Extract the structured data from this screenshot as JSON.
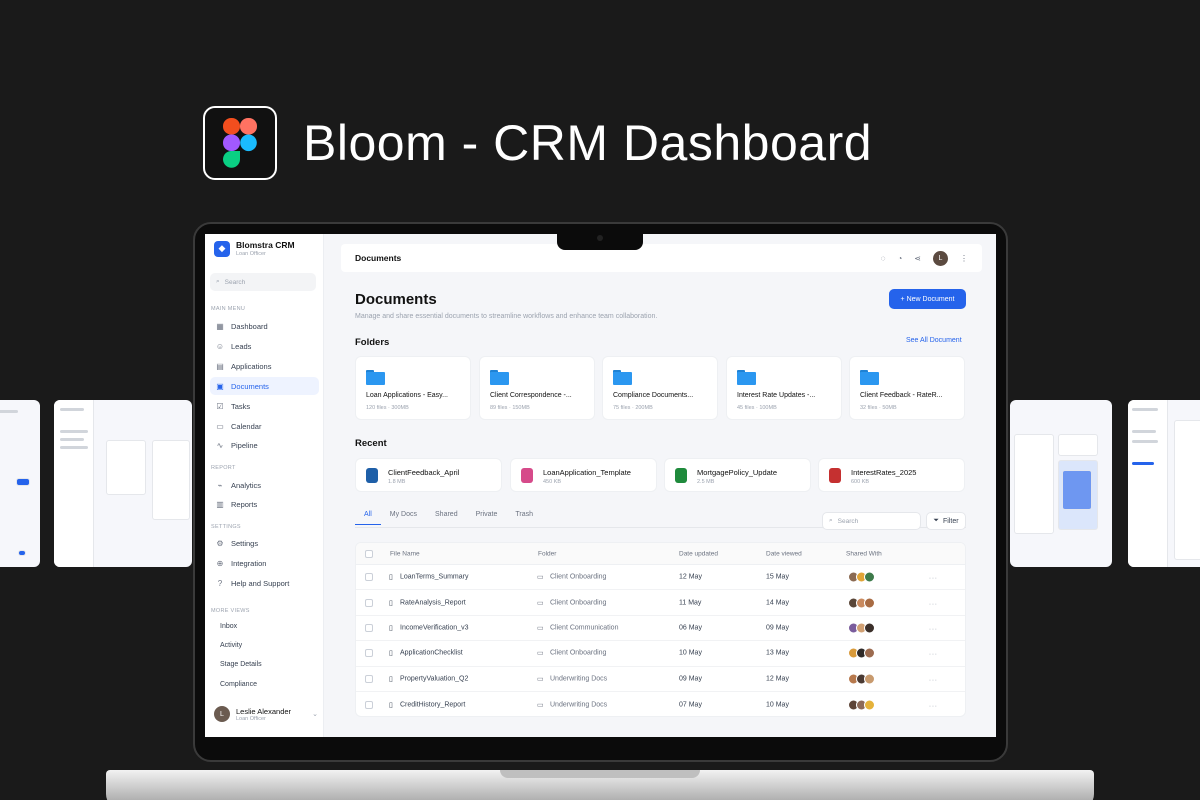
{
  "hero": {
    "title": "Bloom - CRM Dashboard",
    "logo_icon": "figma-logo-icon"
  },
  "sidebar": {
    "brand_name": "Blomstra CRM",
    "brand_role": "Loan Officer",
    "search_placeholder": "Search",
    "main_menu_title": "MAIN MENU",
    "main_items": [
      {
        "label": "Dashboard",
        "icon": "grid-icon"
      },
      {
        "label": "Leads",
        "icon": "users-icon"
      },
      {
        "label": "Applications",
        "icon": "document-icon"
      },
      {
        "label": "Documents",
        "icon": "file-icon",
        "active": true
      },
      {
        "label": "Tasks",
        "icon": "checkbox-icon"
      },
      {
        "label": "Calendar",
        "icon": "calendar-icon"
      },
      {
        "label": "Pipeline",
        "icon": "pipeline-icon"
      }
    ],
    "report_title": "REPORT",
    "report_items": [
      {
        "label": "Analytics",
        "icon": "analytics-icon"
      },
      {
        "label": "Reports",
        "icon": "reports-icon"
      }
    ],
    "settings_title": "SETTINGS",
    "settings_items": [
      {
        "label": "Settings",
        "icon": "gear-icon"
      },
      {
        "label": "Integration",
        "icon": "integration-icon"
      },
      {
        "label": "Help and Support",
        "icon": "help-icon"
      }
    ],
    "more_views_title": "MORE VIEWS",
    "more_views": [
      "Inbox",
      "Activity",
      "Stage Details",
      "Compliance"
    ],
    "user": {
      "name": "Leslie Alexander",
      "role": "Loan Officer"
    }
  },
  "topbar": {
    "title": "Documents"
  },
  "page": {
    "title": "Documents",
    "subtitle": "Manage and share essential documents to streamline workflows and enhance team collaboration.",
    "new_button": "+ New Document",
    "folders_title": "Folders",
    "see_all": "See All Document",
    "recent_title": "Recent",
    "search_placeholder": "Search",
    "filter_label": "Filter"
  },
  "folders": [
    {
      "name": "Loan Applications - Easy...",
      "meta": "120 files · 300MB"
    },
    {
      "name": "Client Correspondence -...",
      "meta": "89 files · 150MB"
    },
    {
      "name": "Compliance Documents...",
      "meta": "75 files · 200MB"
    },
    {
      "name": "Interest Rate Updates -...",
      "meta": "45 files · 100MB"
    },
    {
      "name": "Client Feedback - RateR...",
      "meta": "32 files · 50MB"
    }
  ],
  "recent": [
    {
      "name": "ClientFeedback_April",
      "size": "1.8 MB",
      "color": "#1e5fa8"
    },
    {
      "name": "LoanApplication_Template",
      "size": "450 KB",
      "color": "#d64a8a"
    },
    {
      "name": "MortgagePolicy_Update",
      "size": "2.5 MB",
      "color": "#1f8a3c"
    },
    {
      "name": "InterestRates_2025",
      "size": "600 KB",
      "color": "#c53030"
    }
  ],
  "tabs": [
    "All",
    "My Docs",
    "Shared",
    "Private",
    "Trash"
  ],
  "table": {
    "columns": [
      "File Name",
      "Folder",
      "Date updated",
      "Date viewed",
      "Shared With"
    ],
    "rows": [
      {
        "file": "LoanTerms_Summary",
        "folder": "Client Onboarding",
        "updated": "12 May",
        "viewed": "15 May"
      },
      {
        "file": "RateAnalysis_Report",
        "folder": "Client Onboarding",
        "updated": "11 May",
        "viewed": "14 May"
      },
      {
        "file": "IncomeVerification_v3",
        "folder": "Client Communication",
        "updated": "06 May",
        "viewed": "09 May"
      },
      {
        "file": "ApplicationChecklist",
        "folder": "Client Onboarding",
        "updated": "10 May",
        "viewed": "13 May"
      },
      {
        "file": "PropertyValuation_Q2",
        "folder": "Underwriting Docs",
        "updated": "09 May",
        "viewed": "12 May"
      },
      {
        "file": "CreditHistory_Report",
        "folder": "Underwriting Docs",
        "updated": "07 May",
        "viewed": "10 May"
      }
    ],
    "more_label": "..."
  },
  "colors": {
    "accent": "#2563eb",
    "background": "#1a1a1a"
  }
}
